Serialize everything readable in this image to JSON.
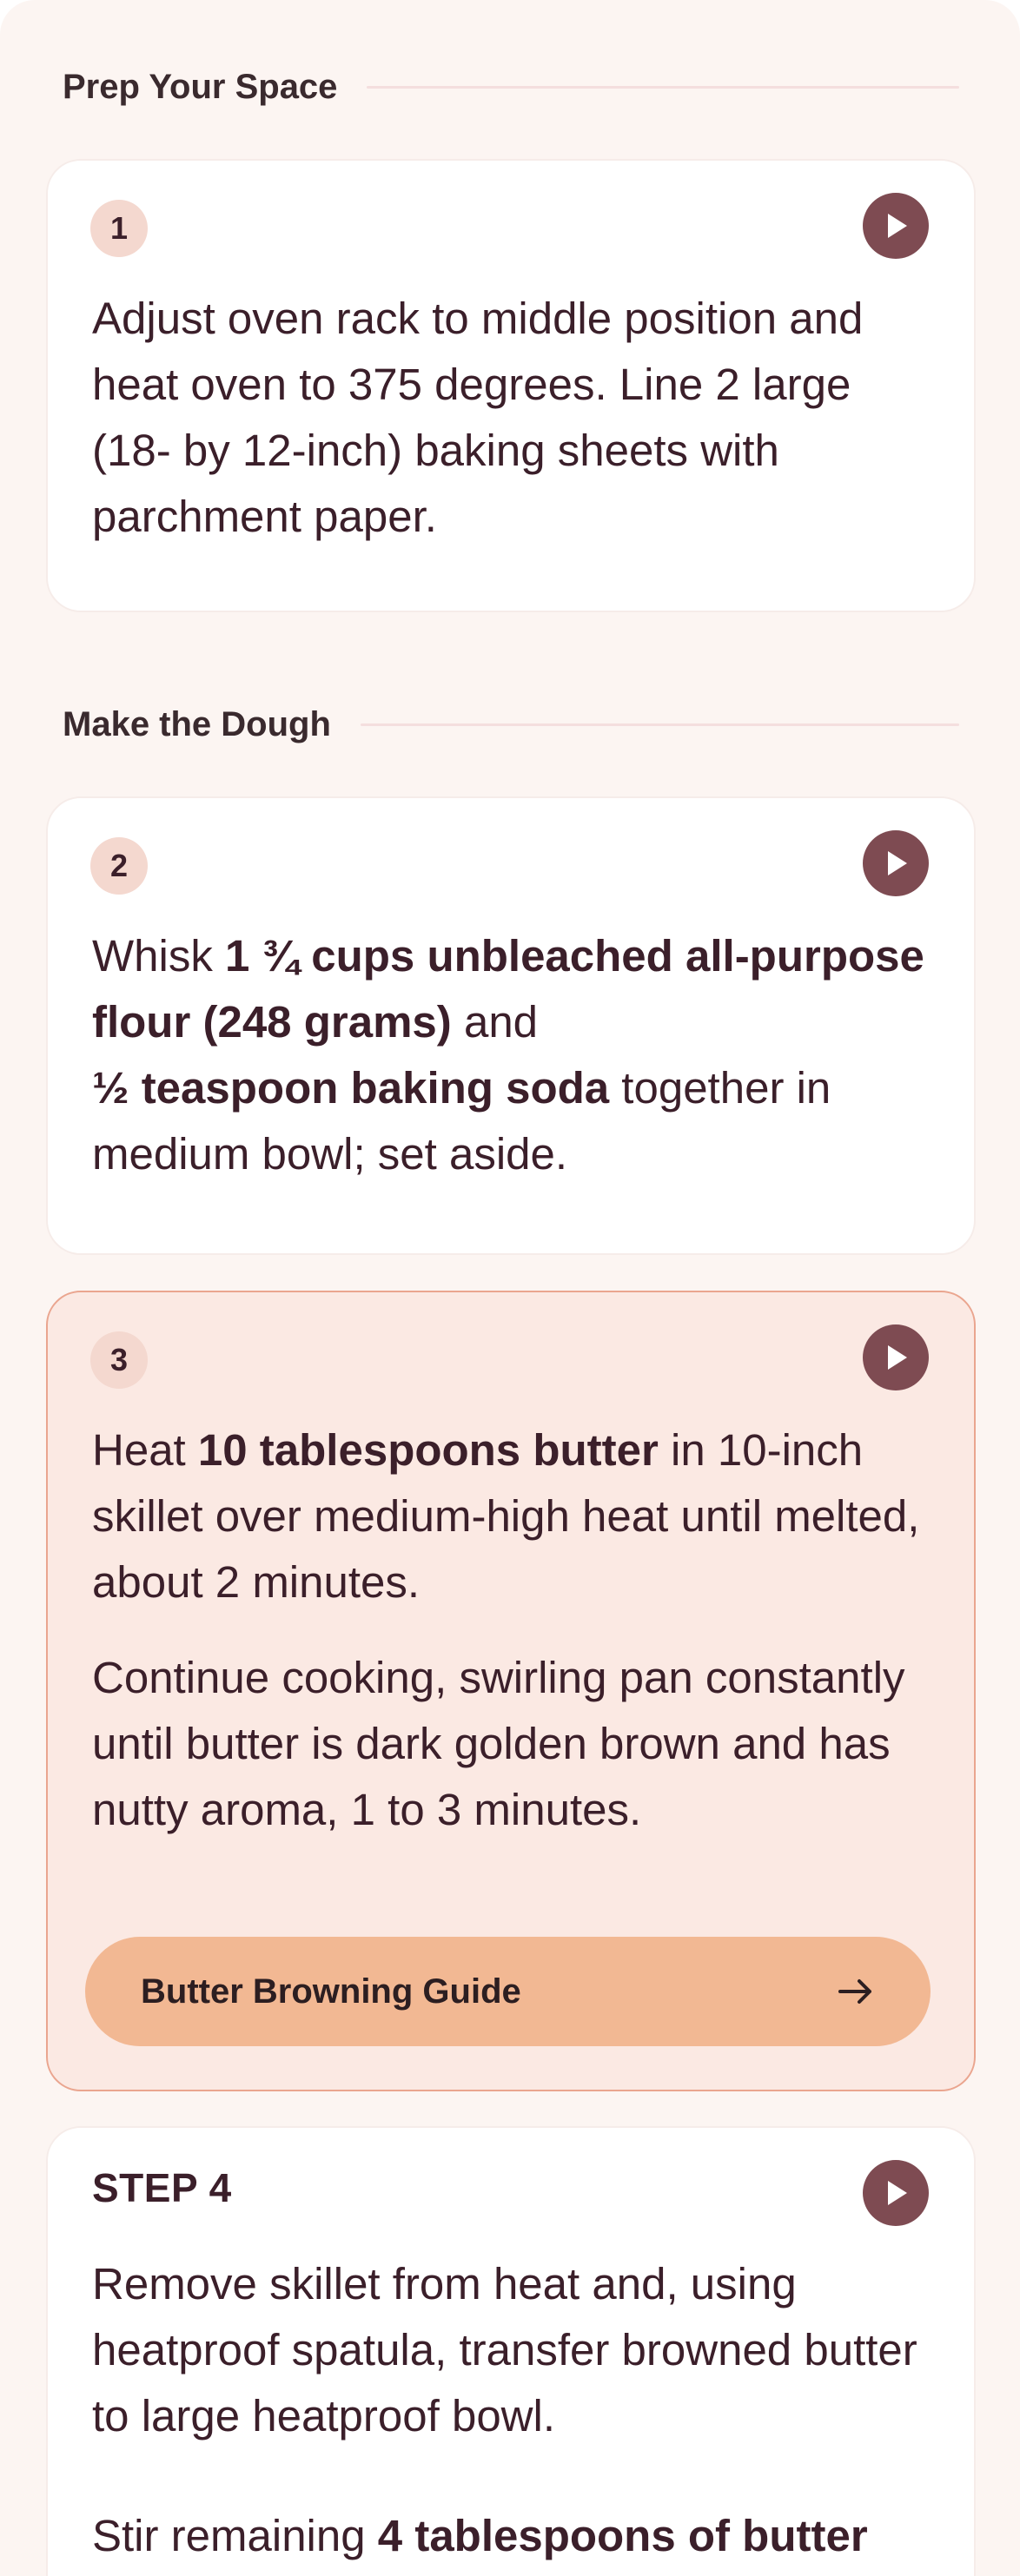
{
  "sections": [
    {
      "title": "Prep Your Space"
    },
    {
      "title": "Make the Dough"
    }
  ],
  "steps": [
    {
      "number": "1",
      "text": "Adjust oven rack to middle position and heat oven to 375 degrees. Line 2 large (18- by 12-inch) baking sheets with parchment paper."
    },
    {
      "number": "2",
      "parts": [
        "Whisk ",
        "1 ¾ cups unbleached all-purpose flour (248 grams)",
        " and ",
        "½ teaspoon baking soda",
        " together in medium bowl; set aside."
      ]
    },
    {
      "number": "3",
      "p1": [
        "Heat ",
        "10 tablespoons butter",
        " in 10-inch skillet over medium-high heat until melted, about 2 minutes."
      ],
      "p2": "Continue cooking, swirling pan constantly until butter is dark golden brown and has nutty aroma, 1 to 3 minutes.",
      "guide_button": "Butter Browning Guide"
    },
    {
      "label": "STEP 4",
      "p1": "Remove skillet from heat and, using heatproof spatula, transfer browned butter to large heatproof bowl.",
      "p2": [
        "Stir remaining ",
        "4 tablespoons of butter"
      ]
    }
  ],
  "colors": {
    "page_bg": "#fcf5f2",
    "active_card_bg": "#fbe9e3",
    "active_card_border": "#eaa58f",
    "play_button": "#7e4b52",
    "guide_button_bg": "#f2b893",
    "badge_bg": "#f4d8cf",
    "text": "#3b1f2a"
  },
  "icons": {
    "play": "play-icon",
    "arrow": "arrow-right-icon"
  }
}
